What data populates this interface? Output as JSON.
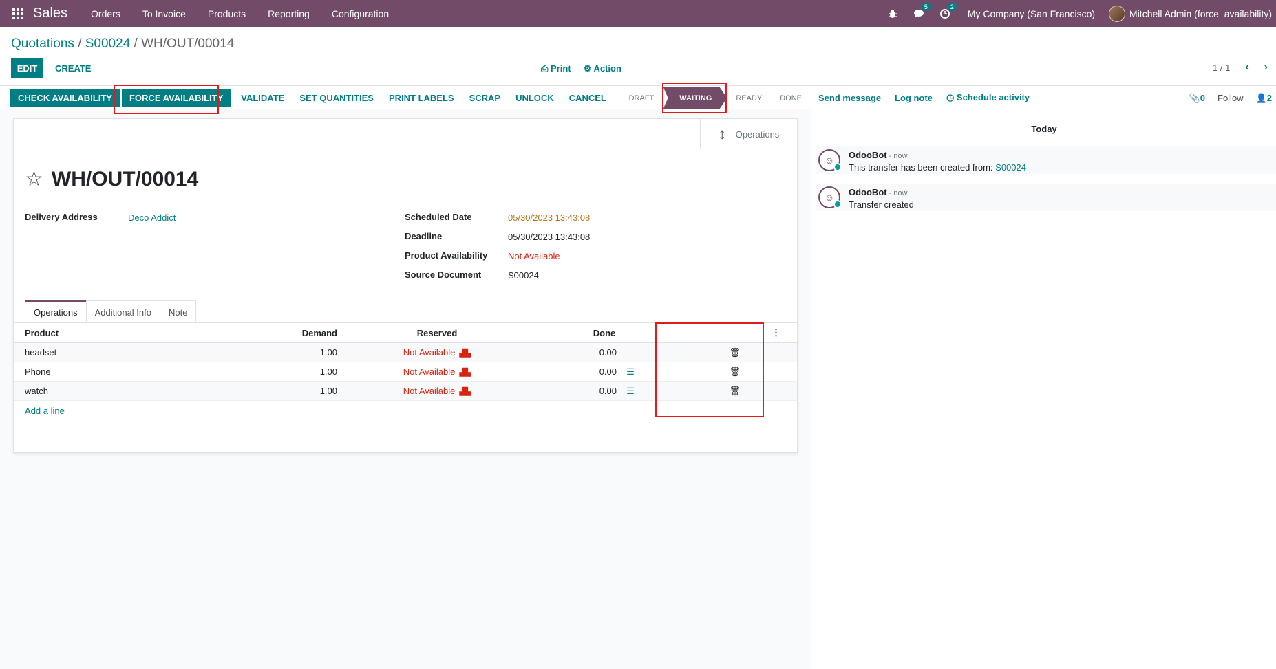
{
  "topbar": {
    "app_name": "Sales",
    "menus": [
      "Orders",
      "To Invoice",
      "Products",
      "Reporting",
      "Configuration"
    ],
    "messages_count": "5",
    "activities_count": "2",
    "company": "My Company (San Francisco)",
    "user": "Mitchell Admin (force_availability)",
    "brand_color": "#714B67"
  },
  "breadcrumb": {
    "level1": "Quotations",
    "level2": "S00024",
    "current": "WH/OUT/00014",
    "separator": "/"
  },
  "control": {
    "edit_label": "EDIT",
    "create_label": "CREATE",
    "print_label": "Print",
    "action_label": "Action",
    "pager": "1 / 1"
  },
  "statusbar": {
    "buttons": [
      "CHECK AVAILABILITY",
      "FORCE AVAILABILITY",
      "VALIDATE",
      "SET QUANTITIES",
      "PRINT LABELS",
      "SCRAP",
      "UNLOCK",
      "CANCEL"
    ],
    "stages": [
      "DRAFT",
      "WAITING",
      "READY",
      "DONE"
    ],
    "active_stage": "WAITING"
  },
  "form": {
    "smart_button": "Operations",
    "title": "WH/OUT/00014",
    "delivery_address_label": "Delivery Address",
    "delivery_address": "Deco Addict",
    "scheduled_date_label": "Scheduled Date",
    "scheduled_date": "05/30/2023 13:43:08",
    "deadline_label": "Deadline",
    "deadline": "05/30/2023 13:43:08",
    "availability_label": "Product Availability",
    "availability": "Not Available",
    "source_label": "Source Document",
    "source": "S00024",
    "tabs": [
      "Operations",
      "Additional Info",
      "Note"
    ],
    "table": {
      "headers": [
        "Product",
        "Demand",
        "Reserved",
        "Done"
      ],
      "rows": [
        {
          "product": "headset",
          "demand": "1.00",
          "reserved": "Not Available",
          "done": "0.00"
        },
        {
          "product": "Phone",
          "demand": "1.00",
          "reserved": "Not Available",
          "done": "0.00"
        },
        {
          "product": "watch",
          "demand": "1.00",
          "reserved": "Not Available",
          "done": "0.00"
        }
      ],
      "add_line": "Add a line"
    }
  },
  "chatter": {
    "send_message": "Send message",
    "log_note": "Log note",
    "schedule_activity": "Schedule activity",
    "attachments": "0",
    "follow": "Follow",
    "followers": "2",
    "date_separator": "Today",
    "messages": [
      {
        "author": "OdooBot",
        "time": "- now",
        "text": "This transfer has been created from: ",
        "link": "S00024"
      },
      {
        "author": "OdooBot",
        "time": "- now",
        "text": "Transfer created",
        "link": ""
      }
    ]
  },
  "colors": {
    "accent": "#017e84",
    "danger": "#d9230f",
    "warning_date": "#b6761a",
    "highlight": "#e41a1a"
  }
}
